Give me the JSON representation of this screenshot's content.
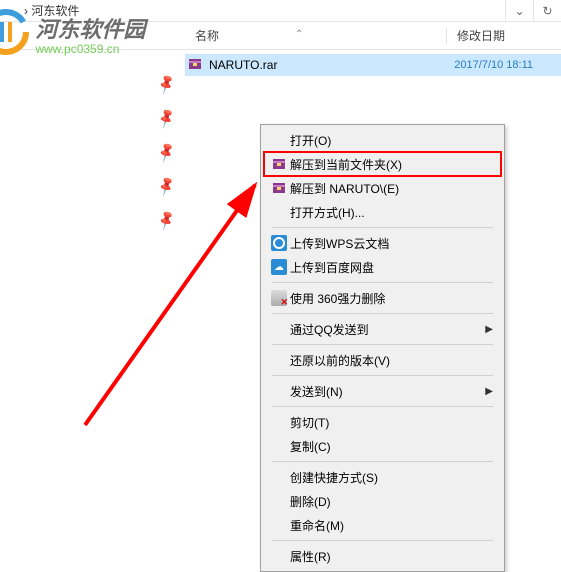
{
  "titlebar": {
    "path": "› 河东软件"
  },
  "columns": {
    "name": "名称",
    "date": "修改日期"
  },
  "file": {
    "name": "NARUTO.rar",
    "date": "2017/7/10 18:11"
  },
  "menu": {
    "open": "打开(O)",
    "extract_here": "解压到当前文件夹(X)",
    "extract_to": "解压到 NARUTO\\(E)",
    "open_with": "打开方式(H)...",
    "wps": "上传到WPS云文档",
    "baidu": "上传到百度网盘",
    "force_delete": "使用 360强力删除",
    "qq_send": "通过QQ发送到",
    "prev_versions": "还原以前的版本(V)",
    "send_to": "发送到(N)",
    "cut": "剪切(T)",
    "copy": "复制(C)",
    "shortcut": "创建快捷方式(S)",
    "delete": "删除(D)",
    "rename": "重命名(M)",
    "properties": "属性(R)"
  },
  "watermark": {
    "title": "河东软件园",
    "url": "www.pc0359.cn"
  }
}
